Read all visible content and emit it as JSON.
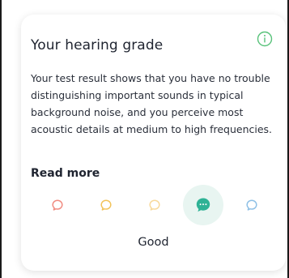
{
  "card": {
    "title": "Your hearing grade",
    "description": "Your test result shows that you have no trouble distinguishing important sounds in typical background noise, and you perceive most acoustic details at medium to high frequencies.",
    "read_more_label": "Read more"
  },
  "icons": {
    "info": "info-circle-icon",
    "grade": "speech-bubble-icon"
  },
  "colors": {
    "accent": "#2eb295",
    "info_icon": "#58c27a",
    "text": "#1f2430",
    "grade_1": "#f08b80",
    "grade_2": "#f2c35a",
    "grade_3": "#f8d99a",
    "grade_4": "#2eb295",
    "grade_5": "#8ec0e6",
    "selected_bg": "#e8f5f1"
  },
  "grades": {
    "count": 5,
    "selected_index": 3,
    "selected_label": "Good"
  }
}
